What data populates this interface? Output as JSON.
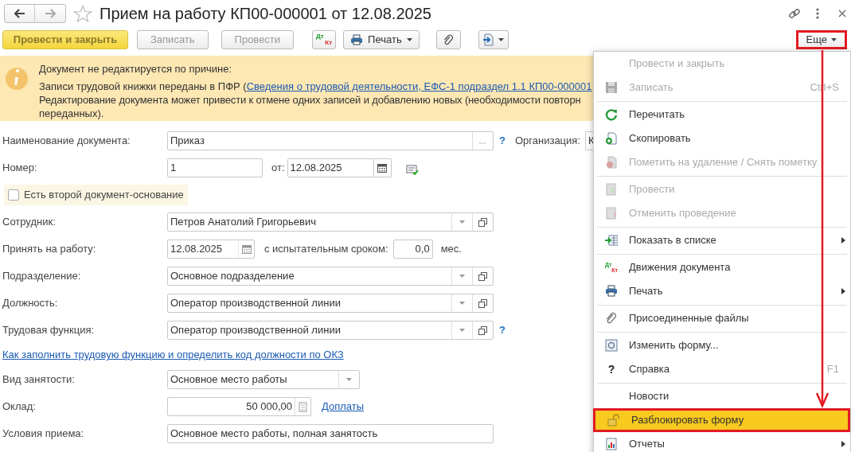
{
  "window": {
    "title": "Прием на работу КП00-000001 от 12.08.2025"
  },
  "toolbar": {
    "buttons": [
      {
        "kind": "primary",
        "label": "Провести и закрыть",
        "disabled": false
      },
      {
        "kind": "plain",
        "label": "Записать",
        "disabled": true
      },
      {
        "kind": "plain",
        "label": "Провести",
        "disabled": true
      },
      {
        "kind": "dtkt",
        "dt": "Дт",
        "kt": "Кт"
      },
      {
        "kind": "print",
        "label": "Печать"
      },
      {
        "kind": "attach"
      },
      {
        "kind": "export"
      }
    ],
    "more": {
      "label": "Еще",
      "annotated": true
    }
  },
  "notice": {
    "title": "Документ не редактируется по причине:",
    "line_start": "Записи трудовой книжки переданы в ПФР (",
    "link": "Сведения о трудовой деятельности, ЕФС-1 подраздел 1.1 КП00-000001",
    "line2": "Редактирование документа может привести к отмене одних записей и добавлению новых (необходимости повторн",
    "line3": "переданных)."
  },
  "form": {
    "rows": [
      {
        "kind": "name",
        "label": "Наименование документа:",
        "value": "Приказ",
        "help": "?",
        "org_label": "Организация:",
        "org_value": "К"
      },
      {
        "kind": "number",
        "label": "Номер:",
        "value": "1",
        "date_label": "от:",
        "date": "12.08.2025"
      },
      {
        "kind": "checkbox",
        "label": "Есть второй документ-основание",
        "checked": false
      },
      {
        "kind": "ref",
        "label": "Сотрудник:",
        "value": "Петров Анатолий Григорьевич"
      },
      {
        "kind": "hire",
        "label": "Принять на работу:",
        "date": "12.08.2025",
        "trial_label": "с испытательным сроком:",
        "trial": "0,0",
        "unit": "мес."
      },
      {
        "kind": "ref",
        "label": "Подразделение:",
        "value": "Основное подразделение"
      },
      {
        "kind": "ref",
        "label": "Должность:",
        "value": "Оператор производственной линии"
      },
      {
        "kind": "ref",
        "label": "Трудовая функция:",
        "value": "Оператор производственной линии",
        "help": "?"
      },
      {
        "kind": "link",
        "text": "Как заполнить трудовую функцию и определить код должности по ОКЗ"
      },
      {
        "kind": "select",
        "label": "Вид занятости:",
        "value": "Основное место работы"
      },
      {
        "kind": "salary",
        "label": "Оклад:",
        "value": "50 000,00",
        "link": "Доплаты"
      },
      {
        "kind": "text",
        "label": "Условия приема:",
        "value": "Основное место работы, полная занятость"
      }
    ]
  },
  "menu": {
    "items": [
      {
        "kind": "item",
        "label": "Провести и закрыть",
        "disabled": true,
        "selected": false
      },
      {
        "kind": "item",
        "label": "Записать",
        "disabled": true,
        "shortcut": "Ctrl+S",
        "selected": false
      },
      {
        "kind": "separator"
      },
      {
        "kind": "item",
        "label": "Перечитать",
        "disabled": false,
        "selected": false
      },
      {
        "kind": "item",
        "label": "Скопировать",
        "disabled": false,
        "selected": false
      },
      {
        "kind": "item",
        "label": "Пометить на удаление / Снять пометку",
        "disabled": true,
        "selected": false
      },
      {
        "kind": "separator"
      },
      {
        "kind": "item",
        "label": "Провести",
        "disabled": true,
        "selected": false
      },
      {
        "kind": "item",
        "label": "Отменить проведение",
        "disabled": true,
        "selected": false
      },
      {
        "kind": "separator"
      },
      {
        "kind": "item",
        "label": "Показать в списке",
        "disabled": false,
        "submenu": true,
        "selected": false
      },
      {
        "kind": "separator"
      },
      {
        "kind": "item",
        "label": "Движения документа",
        "disabled": false,
        "icon_text": [
          "Дт",
          "Кт"
        ],
        "selected": false
      },
      {
        "kind": "item",
        "label": "Печать",
        "disabled": false,
        "submenu": true,
        "selected": false
      },
      {
        "kind": "separator"
      },
      {
        "kind": "item",
        "label": "Присоединенные файлы",
        "disabled": false,
        "selected": false
      },
      {
        "kind": "separator"
      },
      {
        "kind": "item",
        "label": "Изменить форму...",
        "disabled": false,
        "selected": false
      },
      {
        "kind": "item",
        "label": "Справка",
        "disabled": false,
        "icon_char": "?",
        "shortcut": "F1",
        "selected": false
      },
      {
        "kind": "separator"
      },
      {
        "kind": "item",
        "label": "Новости",
        "disabled": false,
        "selected": false
      },
      {
        "kind": "item",
        "label": "Разблокировать форму",
        "disabled": false,
        "selected": true,
        "annotated": true
      },
      {
        "kind": "item",
        "label": "Отчеты",
        "disabled": false,
        "submenu": true,
        "selected": false
      }
    ]
  }
}
